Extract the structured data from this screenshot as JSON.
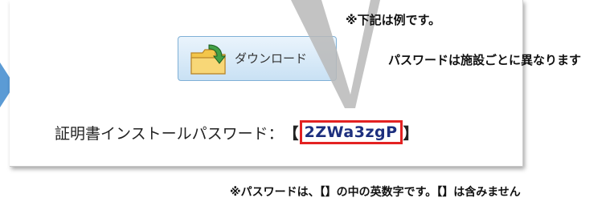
{
  "notes": {
    "example": "※下記は例です。",
    "varies": "パスワードは施設ごとに異なります",
    "bottom": "※パスワードは、【】の中の英数字です。【】は含みません"
  },
  "download_button": {
    "label": "ダウンロード",
    "icon": "folder-download-icon"
  },
  "certificate_password": {
    "label": "証明書インストールパスワード：",
    "open_bracket": "【",
    "value": "2ZWa3zgP",
    "close_bracket": "】"
  },
  "colors": {
    "highlight_box": "#e32222",
    "password_text": "#1d2f7e",
    "side_arrow": "#5b9bd5",
    "callout": "#b8b8b8"
  }
}
